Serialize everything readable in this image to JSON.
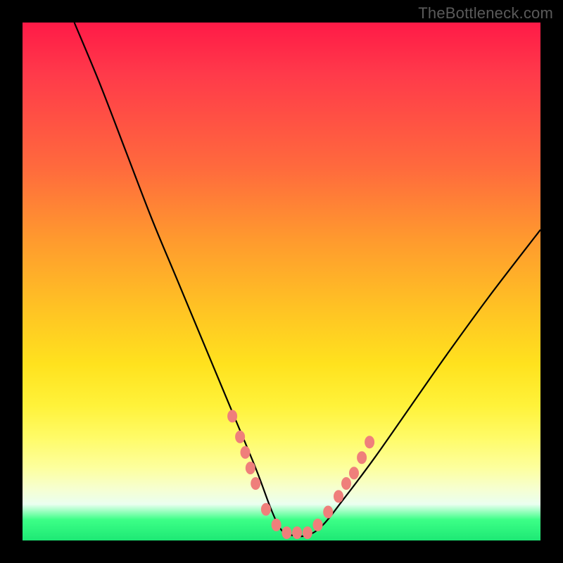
{
  "watermark": {
    "text": "TheBottleneck.com"
  },
  "chart_data": {
    "type": "line",
    "title": "",
    "xlabel": "",
    "ylabel": "",
    "xlim": [
      0,
      100
    ],
    "ylim": [
      0,
      100
    ],
    "grid": false,
    "series": [
      {
        "name": "bottleneck-curve",
        "x": [
          10,
          15,
          20,
          25,
          30,
          35,
          40,
          45,
          48,
          50,
          52,
          55,
          58,
          62,
          68,
          75,
          82,
          90,
          100
        ],
        "values": [
          100,
          88,
          75,
          62,
          50,
          38,
          26,
          14,
          6,
          2,
          1,
          1,
          3,
          8,
          16,
          26,
          36,
          47,
          60
        ]
      }
    ],
    "markers": {
      "name": "highlight-dots",
      "color": "#ef7f7b",
      "x": [
        40.5,
        42.0,
        43.0,
        44.0,
        45.0,
        47.0,
        49.0,
        51.0,
        53.0,
        55.0,
        57.0,
        59.0,
        61.0,
        62.5,
        64.0,
        65.5,
        67.0
      ],
      "values": [
        24.0,
        20.0,
        17.0,
        14.0,
        11.0,
        6.0,
        3.0,
        1.5,
        1.5,
        1.5,
        3.0,
        5.5,
        8.5,
        11.0,
        13.0,
        16.0,
        19.0
      ]
    },
    "background_gradient": {
      "stops": [
        {
          "pct": 0,
          "color": "#ff1a47"
        },
        {
          "pct": 55,
          "color": "#ffc224"
        },
        {
          "pct": 86,
          "color": "#fdff9e"
        },
        {
          "pct": 96,
          "color": "#3cff87"
        },
        {
          "pct": 100,
          "color": "#1de874"
        }
      ]
    }
  }
}
